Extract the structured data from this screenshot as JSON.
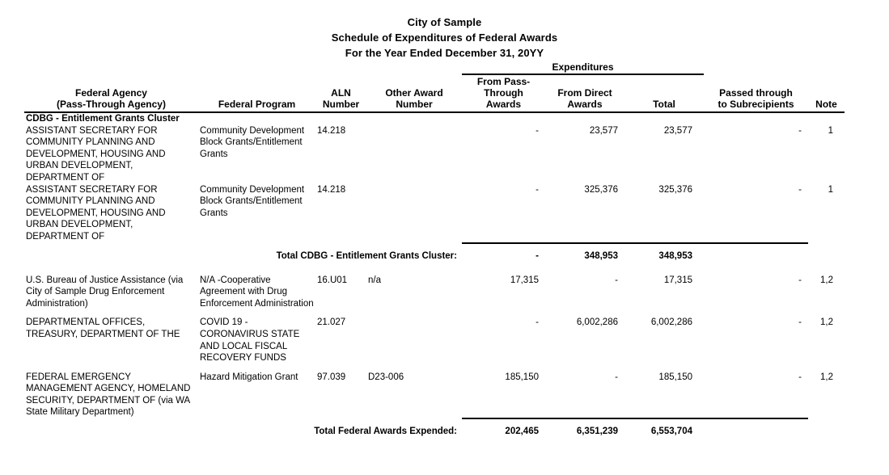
{
  "document": {
    "title_lines": [
      "City of Sample",
      "Schedule of Expenditures of Federal Awards",
      "For the Year Ended December 31, 20YY"
    ]
  },
  "table": {
    "group_header": "Expenditures",
    "columns": {
      "agency_line1": "Federal Agency",
      "agency_line2": "(Pass-Through Agency)",
      "program": "Federal Program",
      "aln_line1": "ALN",
      "aln_line2": "Number",
      "other_line1": "Other Award",
      "other_line2": "Number",
      "pass_line1": "From Pass-",
      "pass_line2": "Through",
      "pass_line3": "Awards",
      "direct_line1": "From Direct",
      "direct_line2": "Awards",
      "total": "Total",
      "sub_line1": "Passed through",
      "sub_line2": "to Subrecipients",
      "note": "Note"
    },
    "cluster_heading": "CDBG - Entitlement Grants Cluster",
    "rows": [
      {
        "agency": "ASSISTANT SECRETARY FOR COMMUNITY PLANNING AND DEVELOPMENT, HOUSING AND URBAN DEVELOPMENT, DEPARTMENT OF",
        "program": "Community Development Block Grants/Entitlement Grants",
        "aln": "14.218",
        "other_award": "",
        "from_pass_through": "-",
        "from_direct": "23,577",
        "total": "23,577",
        "passed_to_subrecipients": "-",
        "note": "1"
      },
      {
        "agency": "ASSISTANT SECRETARY FOR COMMUNITY PLANNING AND DEVELOPMENT, HOUSING AND URBAN DEVELOPMENT, DEPARTMENT OF",
        "program": "Community Development Block Grants/Entitlement Grants",
        "aln": "14.218",
        "other_award": "",
        "from_pass_through": "-",
        "from_direct": "325,376",
        "total": "325,376",
        "passed_to_subrecipients": "-",
        "note": "1"
      }
    ],
    "cluster_total": {
      "label": "Total CDBG - Entitlement Grants Cluster:",
      "from_pass_through": "-",
      "from_direct": "348,953",
      "total": "348,953",
      "passed_to_subrecipients": "",
      "note": ""
    },
    "rows2": [
      {
        "agency": "U.S. Bureau of Justice Assistance (via City of Sample Drug Enforcement Administration)",
        "program": "N/A -Cooperative Agreement with Drug Enforcement Administration",
        "aln": "16.U01",
        "other_award": "n/a",
        "from_pass_through": "17,315",
        "from_direct": "-",
        "total": "17,315",
        "passed_to_subrecipients": "-",
        "note": "1,2"
      },
      {
        "agency": "DEPARTMENTAL OFFICES, TREASURY, DEPARTMENT OF THE",
        "program": "COVID 19 - CORONAVIRUS STATE AND LOCAL FISCAL RECOVERY FUNDS",
        "aln": "21.027",
        "other_award": "",
        "from_pass_through": "-",
        "from_direct": "6,002,286",
        "total": "6,002,286",
        "passed_to_subrecipients": "-",
        "note": "1,2"
      },
      {
        "agency": "FEDERAL EMERGENCY MANAGEMENT AGENCY, HOMELAND SECURITY, DEPARTMENT OF (via WA State Military Department)",
        "program": "Hazard Mitigation Grant",
        "aln": "97.039",
        "other_award": "D23-006",
        "from_pass_through": "185,150",
        "from_direct": "-",
        "total": "185,150",
        "passed_to_subrecipients": "-",
        "note": "1,2"
      }
    ],
    "grand_total": {
      "label": "Total Federal Awards Expended:",
      "from_pass_through": "202,465",
      "from_direct": "6,351,239",
      "total": "6,553,704",
      "passed_to_subrecipients": "",
      "note": ""
    }
  }
}
